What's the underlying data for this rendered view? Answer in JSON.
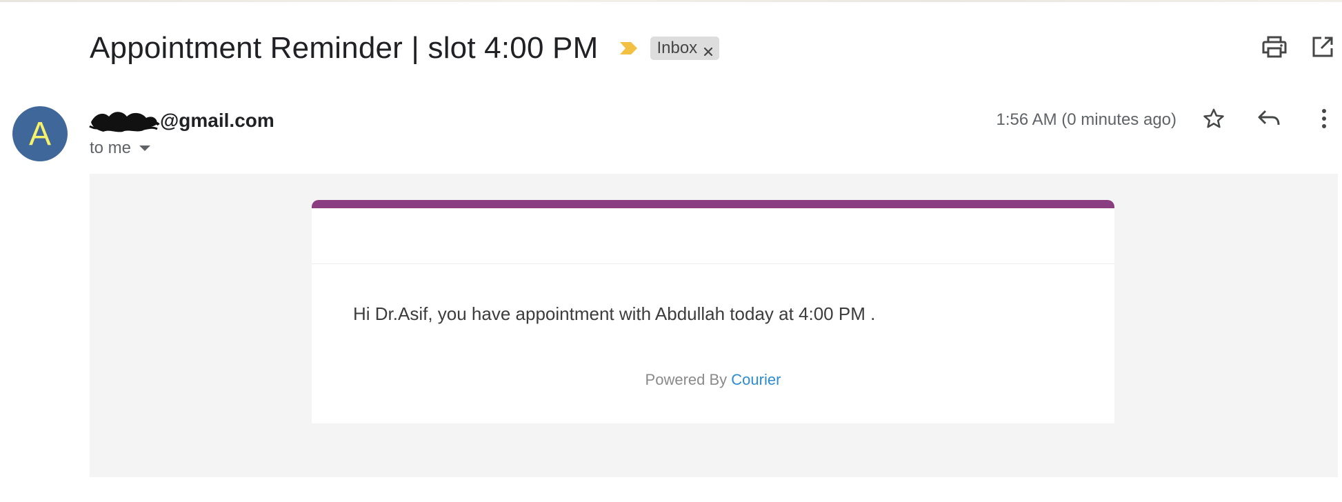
{
  "email": {
    "subject": "Appointment Reminder | slot 4:00 PM",
    "label": "Inbox",
    "sender": {
      "avatar_letter": "A",
      "email_suffix": "@gmail.com",
      "recipient": "to me",
      "timestamp": "1:56 AM (0 minutes ago)"
    },
    "body": {
      "message": "Hi Dr.Asif, you have appointment with Abdullah today at 4:00 PM .",
      "powered_by": "Powered By",
      "powered_link": "Courier"
    }
  },
  "icons": {
    "importance": "importance-marker-icon",
    "remove_label": "close-icon",
    "print": "print-icon",
    "new_window": "open-in-new-window-icon",
    "star": "star-icon",
    "reply": "reply-icon",
    "more": "more-vert-icon",
    "recipient_details": "caret-down-icon"
  },
  "colors": {
    "avatar_bg": "#3f6799",
    "avatar_fg": "#f7f26b",
    "importance": "#f2c043",
    "card_accent": "#8b3d82",
    "link": "#2d8bd0",
    "body_bg": "#f4f4f4"
  }
}
